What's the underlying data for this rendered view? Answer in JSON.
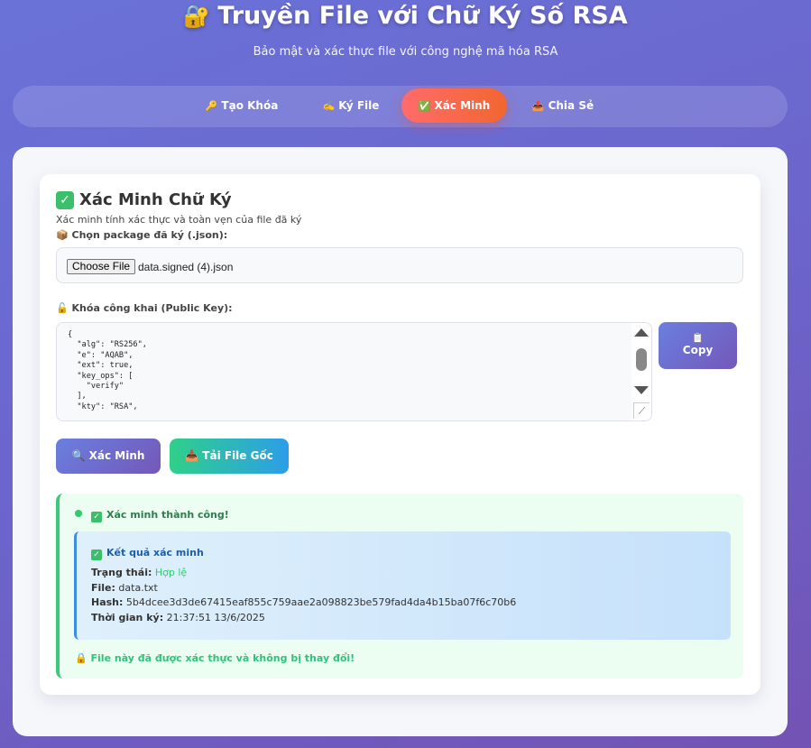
{
  "header": {
    "lock_icon": "🔐",
    "title": "Truyền File với Chữ Ký Số RSA",
    "subtitle": "Bảo mật và xác thực file với công nghệ mã hóa RSA"
  },
  "tabs": [
    {
      "icon": "🔑",
      "label": "Tạo Khóa",
      "active": false
    },
    {
      "icon": "✍️",
      "label": "Ký File",
      "active": false
    },
    {
      "icon": "✅",
      "label": "Xác Minh",
      "active": true
    },
    {
      "icon": "📤",
      "label": "Chia Sẻ",
      "active": false
    }
  ],
  "card": {
    "title": "Xác Minh Chữ Ký",
    "description": "Xác minh tính xác thực và toàn vẹn của file đã ký",
    "package_label": "📦 Chọn package đã ký (.json):",
    "choose_file_label": "Choose File",
    "file_name": "data.signed (4).json",
    "public_key_label": "🔓 Khóa công khai (Public Key):",
    "public_key_text": "{\n  \"alg\": \"RS256\",\n  \"e\": \"AQAB\",\n  \"ext\": true,\n  \"key_ops\": [\n    \"verify\"\n  ],\n  \"kty\": \"RSA\",",
    "copy_icon": "📋",
    "copy_label": "Copy",
    "verify_button": "🔍 Xác Minh",
    "download_button": "📥 Tải File Gốc"
  },
  "result": {
    "header": "Xác minh thành công!",
    "detail_title": "Kết quả xác minh",
    "status_label": "Trạng thái:",
    "status_value": "Hợp lệ",
    "file_label": "File:",
    "file_value": "data.txt",
    "hash_label": "Hash:",
    "hash_value": "5b4dcee3d3de67415eaf855c759aae2a098823be579fad4da4b15ba07f6c70b6",
    "time_label": "Thời gian ký:",
    "time_value": "21:37:51 13/6/2025",
    "footnote": "🔒 File này đã được xác thực và không bị thay đổi!"
  },
  "colors": {
    "accent": "#6a72d8",
    "active_tab": "#f2662f",
    "success": "#2ecc71",
    "info": "#3a8ee6"
  }
}
